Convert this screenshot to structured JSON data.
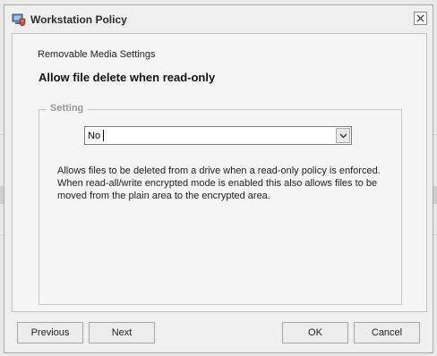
{
  "window": {
    "title": "Workstation Policy",
    "icon": "computer-shield-icon",
    "close_icon": "close-icon"
  },
  "content": {
    "section_label": "Removable Media Settings",
    "setting_title": "Allow file delete when read-only",
    "group_label": "Setting",
    "dropdown": {
      "selected_value": "No",
      "arrow_icon": "chevron-down-icon"
    },
    "description": "Allows files to be deleted from a drive when a read-only policy is enforced. When read-all/write encrypted mode is enabled this also allows files to be moved from the plain area to the encrypted area."
  },
  "footer": {
    "previous_label": "Previous",
    "next_label": "Next",
    "ok_label": "OK",
    "cancel_label": "Cancel"
  }
}
